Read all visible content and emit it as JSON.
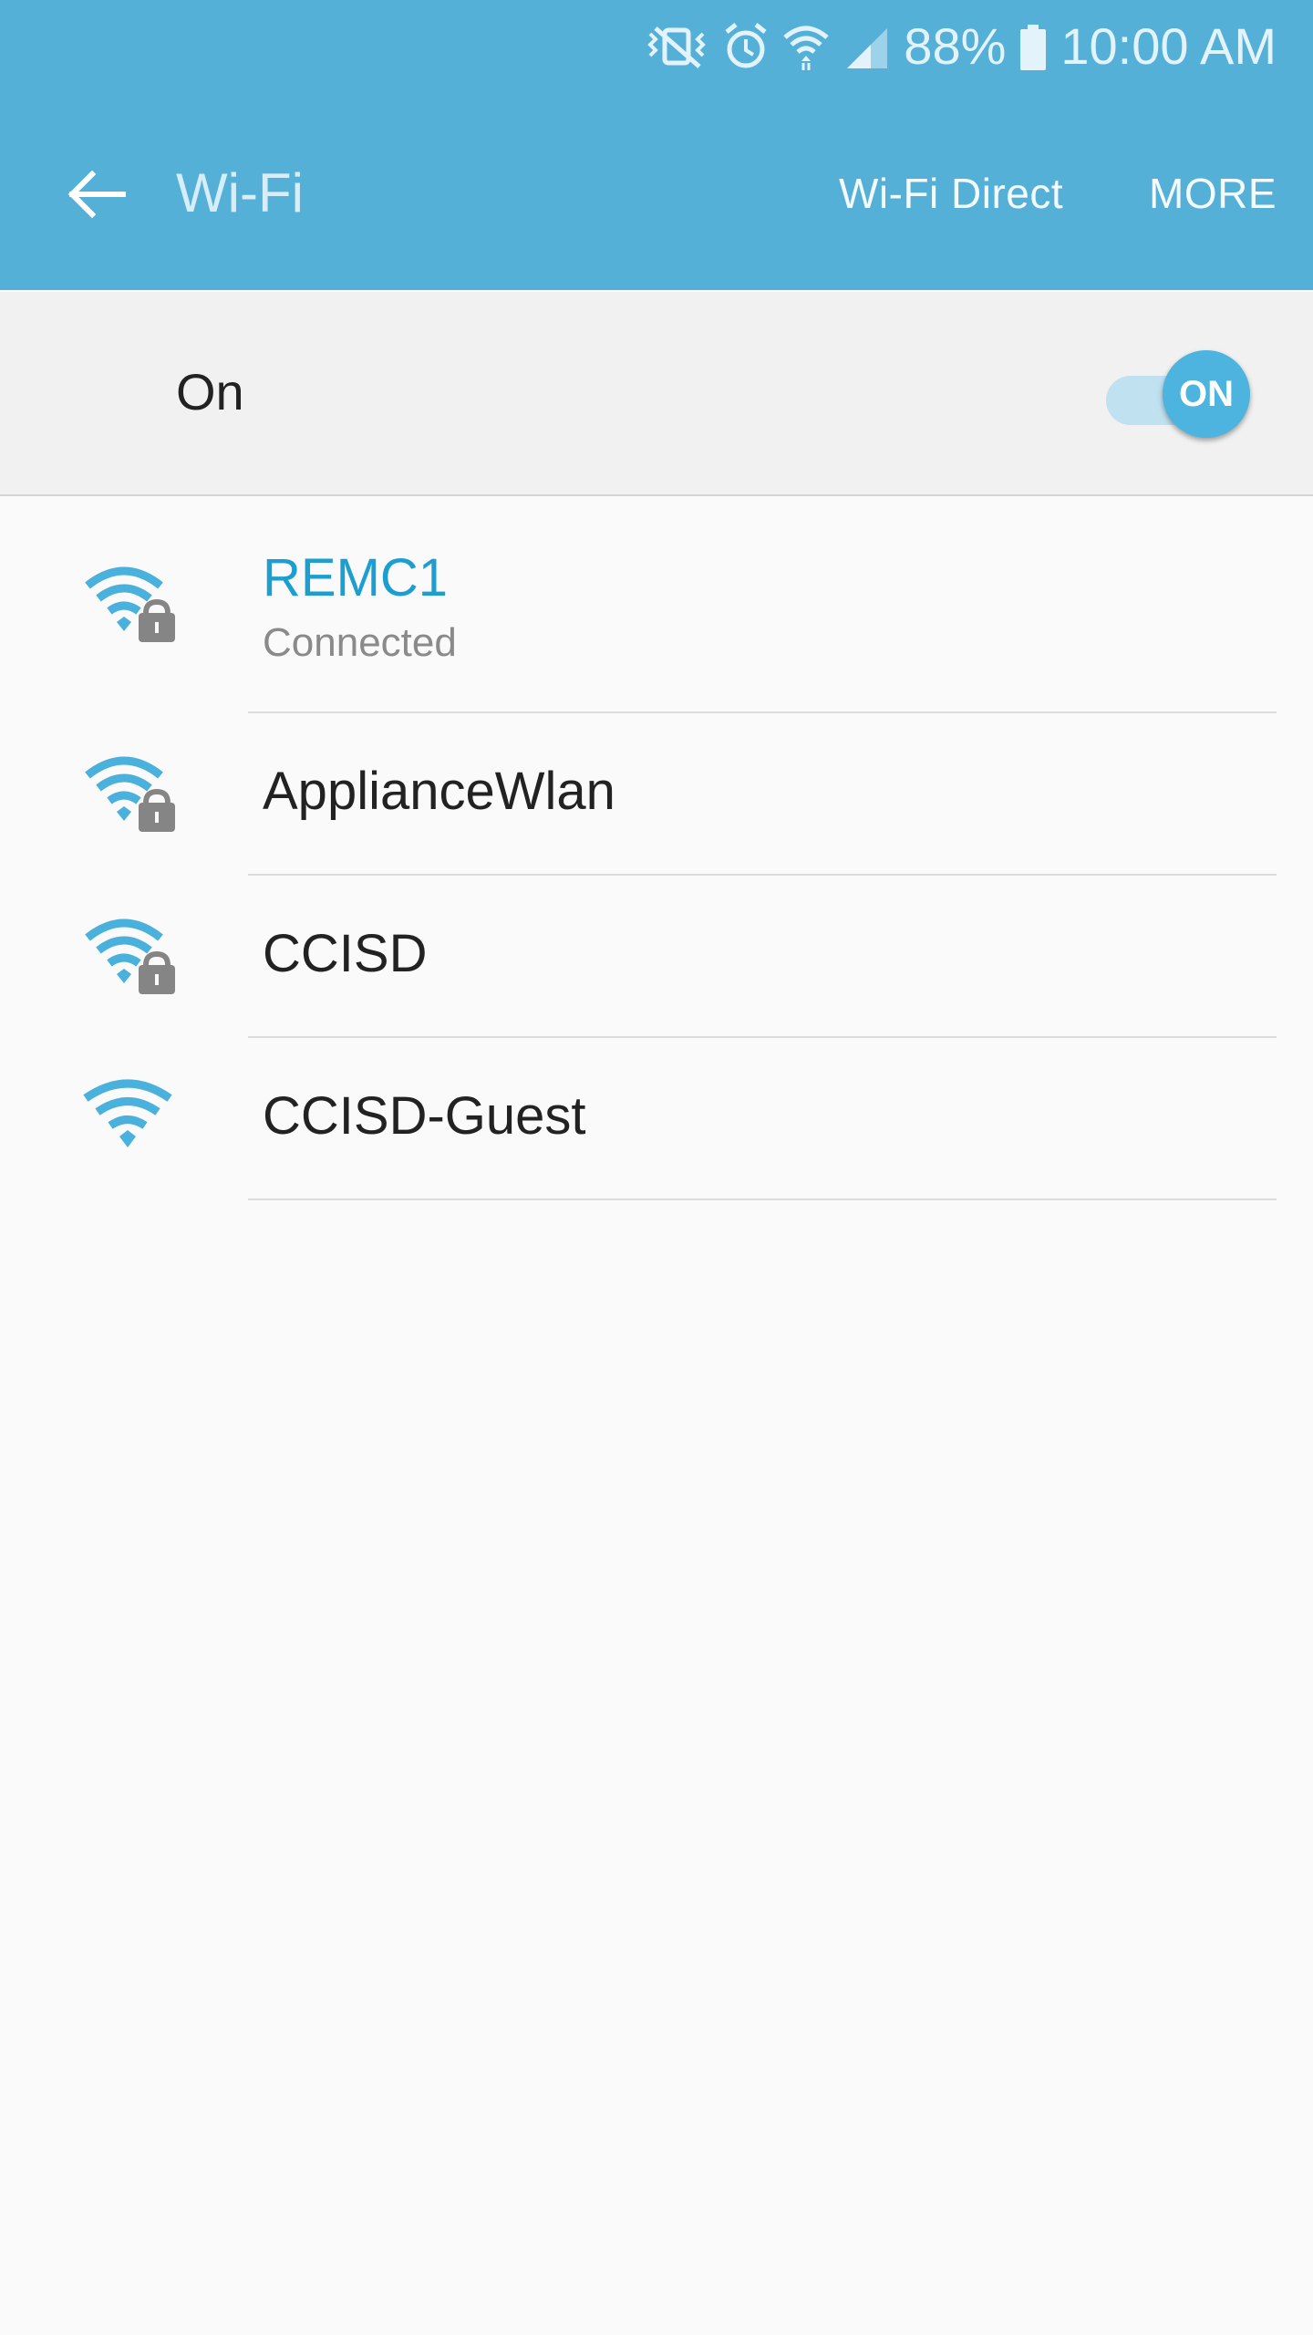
{
  "status_bar": {
    "battery": "88%",
    "time": "10:00 AM",
    "icons": [
      "vibrate-mute-icon",
      "alarm-icon",
      "wifi-status-icon",
      "cell-signal-icon",
      "battery-icon"
    ]
  },
  "app_bar": {
    "title": "Wi-Fi",
    "back_icon": "arrow-left-icon",
    "actions": [
      "Wi-Fi Direct",
      "MORE"
    ]
  },
  "master_switch": {
    "label": "On",
    "toggle_text": "ON",
    "state": true
  },
  "networks": [
    {
      "name": "REMC1",
      "status": "Connected",
      "secured": true,
      "connected": true
    },
    {
      "name": "ApplianceWlan",
      "status": "",
      "secured": true,
      "connected": false
    },
    {
      "name": "CCISD",
      "status": "",
      "secured": true,
      "connected": false
    },
    {
      "name": "CCISD-Guest",
      "status": "",
      "secured": false,
      "connected": false
    }
  ],
  "colors": {
    "app_bar": "#55b0d7",
    "accent": "#1c9fd0",
    "wifi_icon": "#4ab0dc",
    "lock_icon": "#858585"
  }
}
